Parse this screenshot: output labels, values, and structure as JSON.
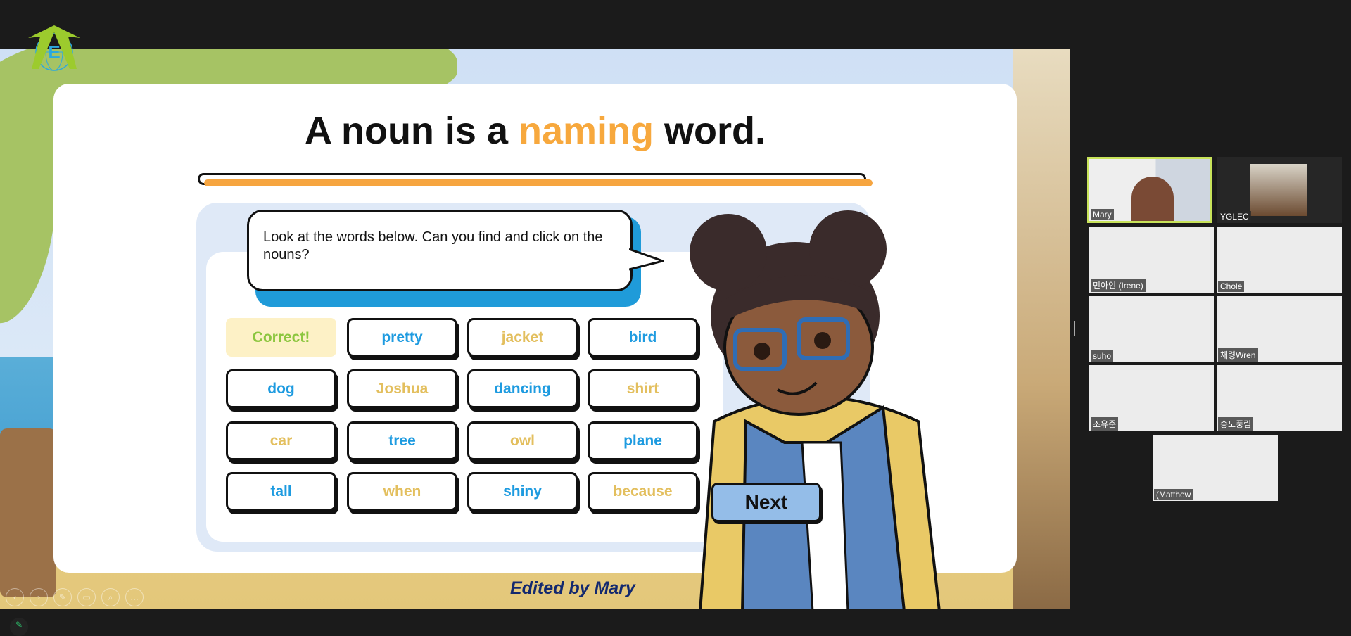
{
  "slide": {
    "title_before": "A noun is a ",
    "title_highlight": "naming",
    "title_after": " word.",
    "instruction": "Look at the words below. Can you find and click on the nouns?",
    "words": [
      {
        "label": "Correct!",
        "color": "#8cc63f",
        "state": "correct"
      },
      {
        "label": "pretty",
        "color": "#1e9be0"
      },
      {
        "label": "jacket",
        "color": "#e3bf5e"
      },
      {
        "label": "bird",
        "color": "#1e9be0"
      },
      {
        "label": "dog",
        "color": "#1e9be0"
      },
      {
        "label": "Joshua",
        "color": "#e3bf5e"
      },
      {
        "label": "dancing",
        "color": "#1e9be0"
      },
      {
        "label": "shirt",
        "color": "#e3bf5e"
      },
      {
        "label": "car",
        "color": "#e3bf5e"
      },
      {
        "label": "tree",
        "color": "#1e9be0"
      },
      {
        "label": "owl",
        "color": "#e3bf5e"
      },
      {
        "label": "plane",
        "color": "#1e9be0"
      },
      {
        "label": "tall",
        "color": "#1e9be0"
      },
      {
        "label": "when",
        "color": "#e3bf5e"
      },
      {
        "label": "shiny",
        "color": "#1e9be0"
      },
      {
        "label": "because",
        "color": "#e3bf5e"
      }
    ],
    "next_label": "Next",
    "edited_by": "Edited by Mary",
    "logo_letter": "E"
  },
  "presenter_tools": [
    "‹",
    "›",
    "✎",
    "▭",
    "⌕",
    "…"
  ],
  "participants": [
    {
      "name": "Mary",
      "active": true
    },
    {
      "name": "YGLEC"
    },
    {
      "name": "민아인 (Irene)"
    },
    {
      "name": "Chole"
    },
    {
      "name": "suho"
    },
    {
      "name": "채령Wren"
    },
    {
      "name": "조유준"
    },
    {
      "name": "송도풍림"
    },
    {
      "name": "(Matthew"
    }
  ],
  "colors": {
    "accent": "#f7a83d",
    "bubble": "#1f9bd9",
    "noun_blue": "#1e9be0",
    "non_noun_gold": "#e3bf5e",
    "active_speaker": "#c8e35a"
  }
}
